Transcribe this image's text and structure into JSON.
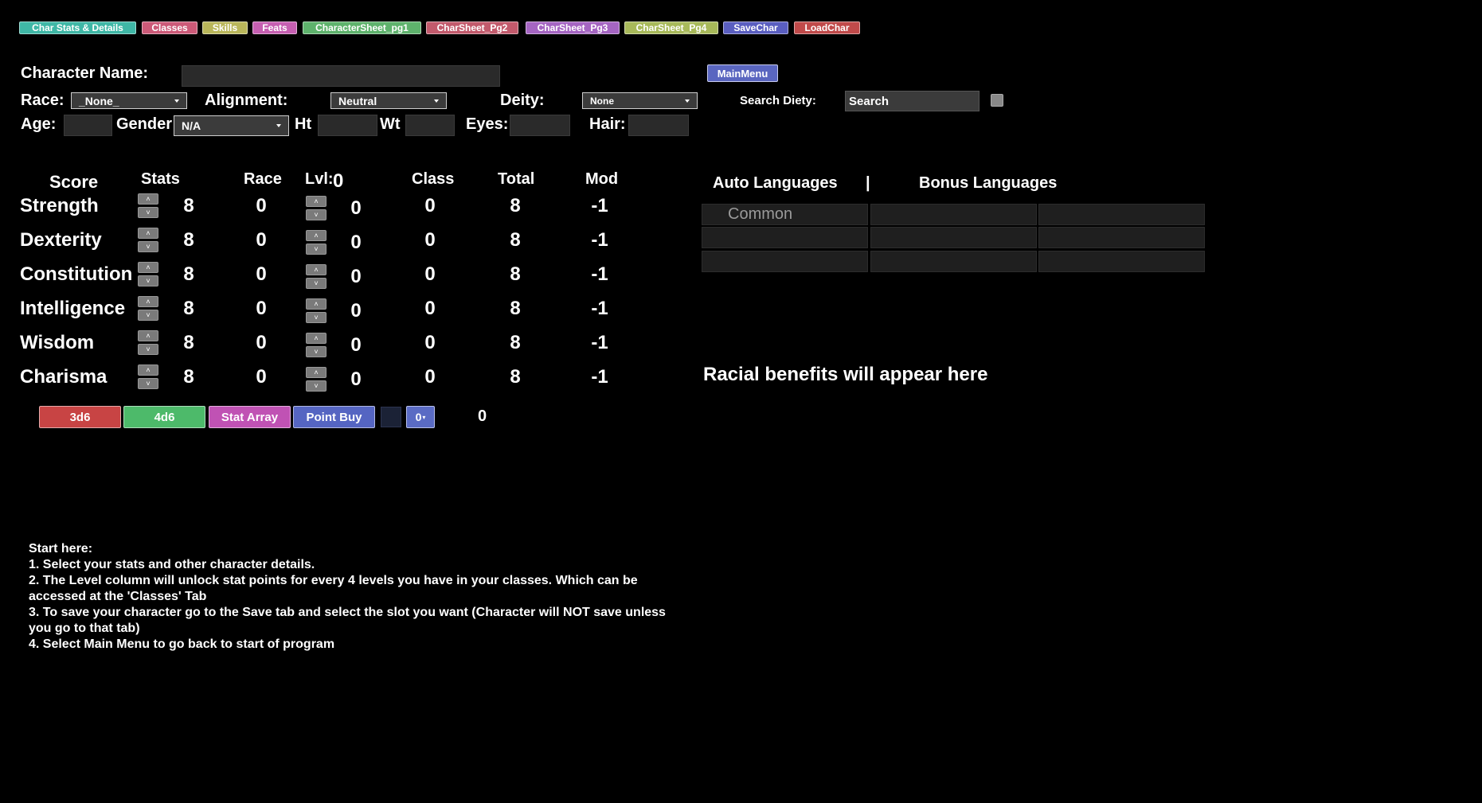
{
  "tabs": [
    {
      "label": "Char Stats & Details",
      "color": "#3fb7a6"
    },
    {
      "label": "Classes",
      "color": "#cc5a78"
    },
    {
      "label": "Skills",
      "color": "#b9b65a"
    },
    {
      "label": "Feats",
      "color": "#c65fb1"
    },
    {
      "label": "CharacterSheet_pg1",
      "color": "#5eb26c"
    },
    {
      "label": "CharSheet_Pg2",
      "color": "#c25a6c"
    },
    {
      "label": "CharSheet_Pg3",
      "color": "#a565c2"
    },
    {
      "label": "CharSheet_Pg4",
      "color": "#a8b95a"
    },
    {
      "label": "SaveChar",
      "color": "#5a5ec0"
    },
    {
      "label": "LoadChar",
      "color": "#c04a4a"
    }
  ],
  "details": {
    "character_name_label": "Character Name:",
    "main_menu": "MainMenu",
    "race_label": "Race:",
    "race_value": "_None_",
    "alignment_label": "Alignment:",
    "alignment_value": "Neutral",
    "deity_label": "Deity:",
    "deity_value": "None",
    "search_deity_label": "Search Diety:",
    "search_placeholder": "Search",
    "age_label": "Age:",
    "gender_label": "Gender",
    "gender_value": "N/A",
    "ht_label": "Ht",
    "wt_label": "Wt",
    "eyes_label": "Eyes:",
    "hair_label": "Hair:"
  },
  "stats": {
    "headers": {
      "score": "Score",
      "stats": "Stats",
      "race": "Race",
      "lvl": "Lvl:",
      "lvl_value": "0",
      "class": "Class",
      "total": "Total",
      "mod": "Mod"
    },
    "rows": [
      {
        "name": "Strength",
        "stat": "8",
        "race": "0",
        "lvl": "0",
        "class": "0",
        "total": "8",
        "mod": "-1"
      },
      {
        "name": "Dexterity",
        "stat": "8",
        "race": "0",
        "lvl": "0",
        "class": "0",
        "total": "8",
        "mod": "-1"
      },
      {
        "name": "Constitution",
        "stat": "8",
        "race": "0",
        "lvl": "0",
        "class": "0",
        "total": "8",
        "mod": "-1"
      },
      {
        "name": "Intelligence",
        "stat": "8",
        "race": "0",
        "lvl": "0",
        "class": "0",
        "total": "8",
        "mod": "-1"
      },
      {
        "name": "Wisdom",
        "stat": "8",
        "race": "0",
        "lvl": "0",
        "class": "0",
        "total": "8",
        "mod": "-1"
      },
      {
        "name": "Charisma",
        "stat": "8",
        "race": "0",
        "lvl": "0",
        "class": "0",
        "total": "8",
        "mod": "-1"
      }
    ],
    "spin_up": "˄",
    "spin_down": "˅"
  },
  "roll_buttons": [
    {
      "label": "3d6",
      "color": "#c84444"
    },
    {
      "label": "4d6",
      "color": "#4dba6a"
    },
    {
      "label": "Stat Array",
      "color": "#c052b4"
    },
    {
      "label": "Point Buy",
      "color": "#5565c2"
    }
  ],
  "point_buy": {
    "dropdown_value": "0",
    "points": "0"
  },
  "languages": {
    "auto_label": "Auto Languages",
    "separator": "|",
    "bonus_label": "Bonus Languages",
    "cells": [
      [
        "Common",
        "",
        ""
      ],
      [
        "",
        "",
        ""
      ],
      [
        "",
        "",
        ""
      ]
    ]
  },
  "racial_benefits": "Racial benefits will appear here",
  "instructions": [
    "Start here:",
    "1. Select your stats and other character details.",
    "2. The Level column will unlock stat points for every 4 levels you have in your classes. Which can be accessed at the 'Classes' Tab",
    "3. To save your character go to the Save tab and select the slot you want (Character will NOT save unless you go to that tab)",
    "4. Select Main Menu to go back to start of program"
  ]
}
